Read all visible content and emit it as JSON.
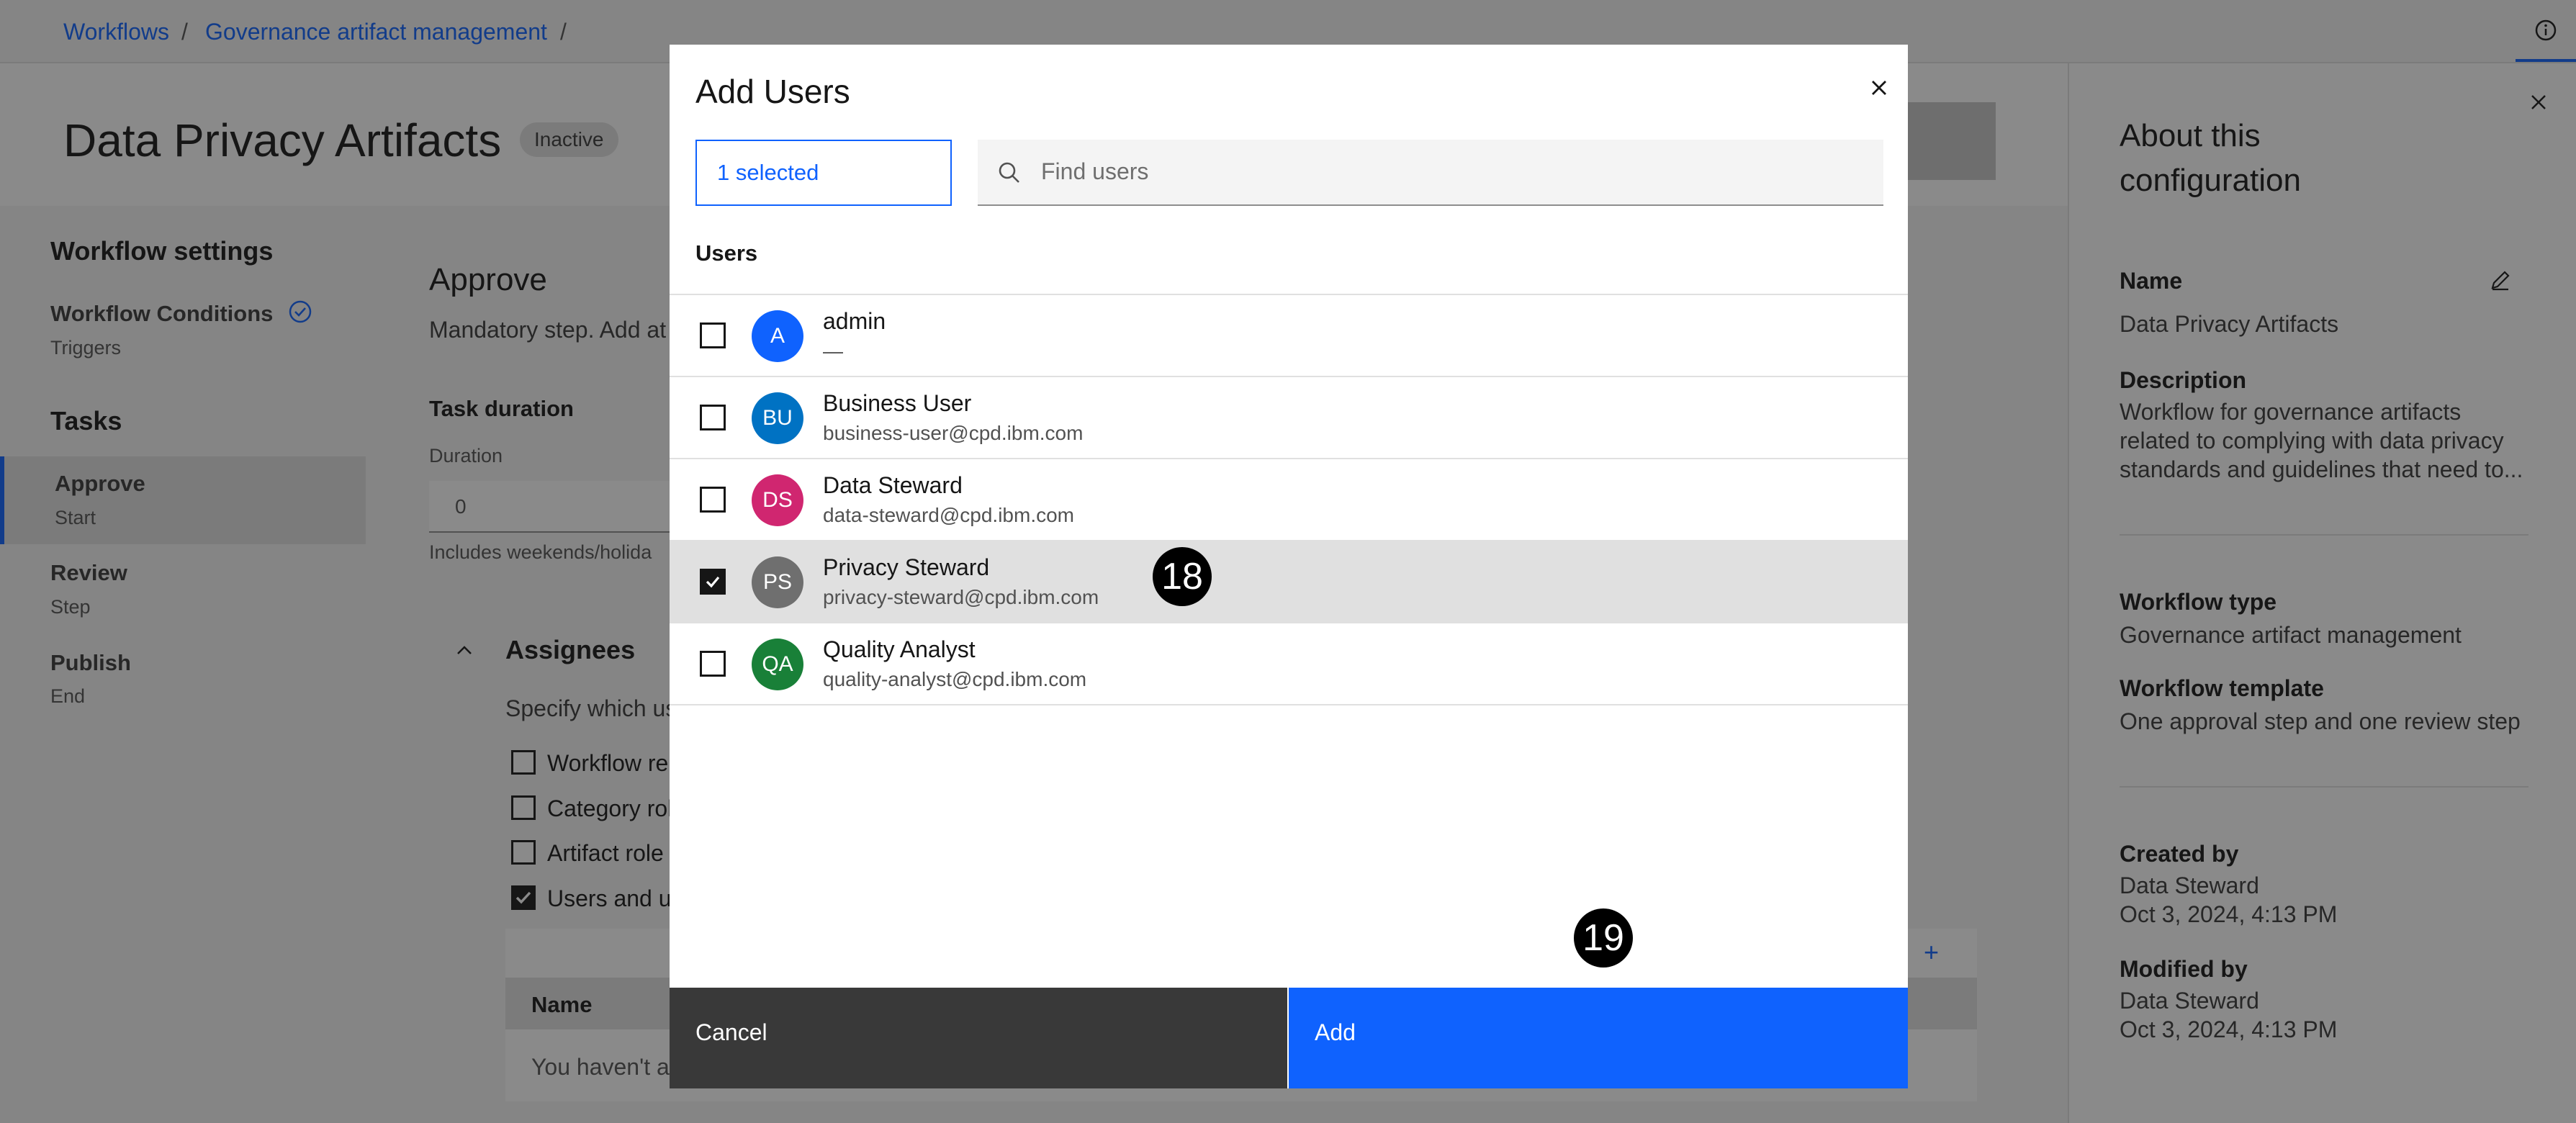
{
  "breadcrumb": {
    "items": [
      "Workflows",
      "Governance artifact management"
    ],
    "separator": "/"
  },
  "page": {
    "title": "Data Privacy Artifacts",
    "status": "Inactive"
  },
  "sidebar": {
    "heading": "Workflow settings",
    "conditions": {
      "label": "Workflow Conditions",
      "sub": "Triggers"
    },
    "tasks_heading": "Tasks",
    "tasks": [
      {
        "label": "Approve",
        "sub": "Start"
      },
      {
        "label": "Review",
        "sub": "Step"
      },
      {
        "label": "Publish",
        "sub": "End"
      }
    ]
  },
  "main": {
    "step_title": "Approve",
    "step_desc": "Mandatory step. Add at",
    "task_duration": "Task duration",
    "duration_label": "Duration",
    "duration_value": "0",
    "duration_hint": "Includes weekends/holida",
    "assignees_title": "Assignees",
    "assignees_desc": "Specify which us",
    "options": [
      {
        "label": "Workflow re",
        "checked": false
      },
      {
        "label": "Category rol",
        "checked": false
      },
      {
        "label": "Artifact role",
        "checked": false
      },
      {
        "label": "Users and u",
        "checked": true
      }
    ],
    "table_header": "Name",
    "table_empty": "You haven't a"
  },
  "about": {
    "title_line1": "About this",
    "title_line2": "configuration",
    "name_label": "Name",
    "name_value": "Data Privacy Artifacts",
    "description_label": "Description",
    "description_lines": [
      "Workflow for governance artifacts",
      "related to complying with data privacy",
      "standards and guidelines that need to..."
    ],
    "workflow_type_label": "Workflow type",
    "workflow_type_value": "Governance artifact management",
    "workflow_template_label": "Workflow template",
    "workflow_template_value": "One approval step and one review step",
    "created_by_label": "Created by",
    "created_by_value": "Data Steward",
    "created_date": "Oct 3, 2024, 4:13 PM",
    "modified_by_label": "Modified by",
    "modified_by_value": "Data Steward",
    "modified_date": "Oct 3, 2024, 4:13 PM"
  },
  "modal": {
    "title": "Add Users",
    "selected_count": "1 selected",
    "search_placeholder": "Find users",
    "users_heading": "Users",
    "users": [
      {
        "initials": "A",
        "name": "admin",
        "email": "—",
        "color": "#0f62fe",
        "checked": false
      },
      {
        "initials": "BU",
        "name": "Business User",
        "email": "business-user@cpd.ibm.com",
        "color": "#0072c3",
        "checked": false
      },
      {
        "initials": "DS",
        "name": "Data Steward",
        "email": "data-steward@cpd.ibm.com",
        "color": "#d02670",
        "checked": false
      },
      {
        "initials": "PS",
        "name": "Privacy Steward",
        "email": "privacy-steward@cpd.ibm.com",
        "color": "#6f6f6f",
        "checked": true
      },
      {
        "initials": "QA",
        "name": "Quality Analyst",
        "email": "quality-analyst@cpd.ibm.com",
        "color": "#198038",
        "checked": false
      }
    ],
    "cancel_label": "Cancel",
    "add_label": "Add"
  },
  "step_badges": {
    "first": "18",
    "second": "19"
  },
  "colors": {
    "accent": "#0f62fe",
    "overlay": "rgba(22,22,22,0.5)",
    "secondary_button": "#393939"
  }
}
